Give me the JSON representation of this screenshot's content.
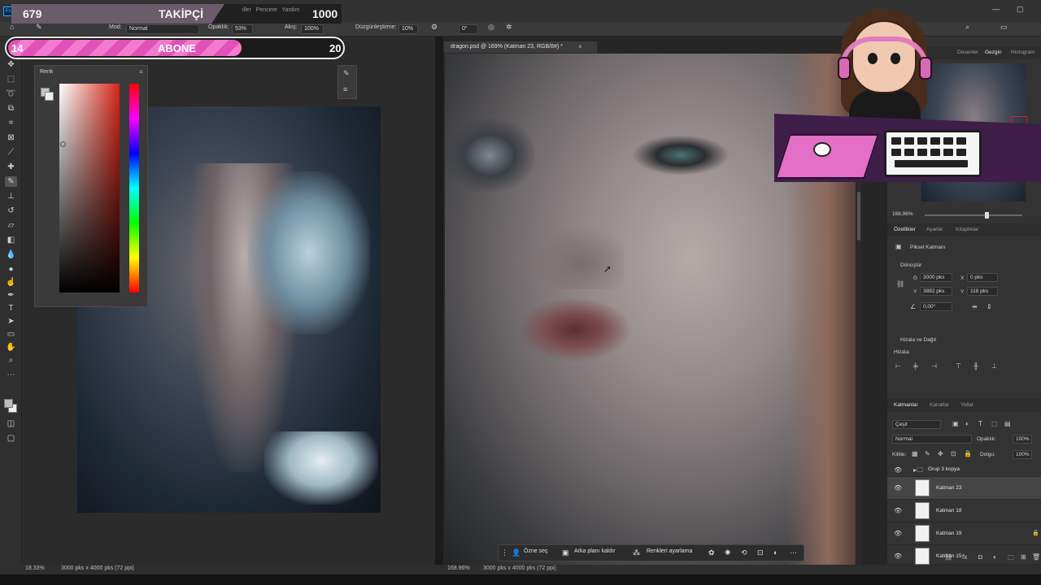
{
  "overlay": {
    "followers": {
      "count": "679",
      "label": "TAKİPÇİ",
      "goal": "1000",
      "progress": 0.679
    },
    "subscribers": {
      "count": "14",
      "label": "ABONE",
      "goal": "20",
      "progress": 0.7
    },
    "menus_visible": [
      "iller",
      "Pencere",
      "Yardım"
    ]
  },
  "options_bar": {
    "mode_label": "Mod:",
    "mode_value": "Normal",
    "opacity_label": "Opaklık:",
    "opacity_value": "53%",
    "flow_label": "Akış:",
    "flow_value": "100%",
    "smoothing_label": "Düzgünleştirme:",
    "smoothing_value": "10%",
    "angle_value": "0°"
  },
  "color_panel": {
    "title": "Renk"
  },
  "document": {
    "tab_title": "dragon.psd @ 169% (Katman 23, RGB/8#) *"
  },
  "contextual_bar": {
    "select_subject": "Özne seç",
    "remove_bg": "Arka planı kaldır",
    "adjust_colors": "Renkleri ayarlama"
  },
  "status": {
    "left_zoom": "18.33%",
    "left_size": "3000 pks x 4000 pks (72 ppi)",
    "right_zoom": "168.96%",
    "right_size": "3000 pks x 4000 pks (72 ppi)"
  },
  "navigator": {
    "tabs": [
      "Desenler",
      "Gezgin",
      "Histogram"
    ],
    "active_tab": "Gezgin",
    "zoom": "168,96%"
  },
  "properties": {
    "tabs": [
      "Özellikler",
      "Ayarlar",
      "Kitaplıklar"
    ],
    "active_tab": "Özellikler",
    "layer_type": "Piksel Katmanı",
    "transform_title": "Dönüştür",
    "w_label": "G",
    "w_value": "3000 pks",
    "h_label": "Y",
    "h_value": "3882 pks",
    "x_label": "X",
    "x_value": "0 pks",
    "y_label": "Y",
    "y_value": "118 pks",
    "angle_value": "0,00°",
    "align_title": "Hizala ve Dağıt",
    "align_sub": "Hizala:"
  },
  "layers": {
    "tabs": [
      "Katmanlar",
      "Kanallar",
      "Yollar"
    ],
    "active_tab": "Katmanlar",
    "filter_label": "Çeşit",
    "blend_mode": "Normal",
    "opacity_label": "Opaklık:",
    "opacity_value": "100%",
    "lock_label": "Kilitle:",
    "fill_label": "Dolgu:",
    "fill_value": "100%",
    "group_name": "Grup 3 kopya",
    "items": [
      {
        "name": "Katman 23",
        "selected": true
      },
      {
        "name": "Katman 18",
        "selected": false
      },
      {
        "name": "Katman 19",
        "selected": false
      },
      {
        "name": "Katman 15",
        "selected": false
      }
    ]
  },
  "colors": {
    "overlay_pink": "#e152b8",
    "panel_bg": "#333333",
    "selection_red": "#d02525"
  }
}
